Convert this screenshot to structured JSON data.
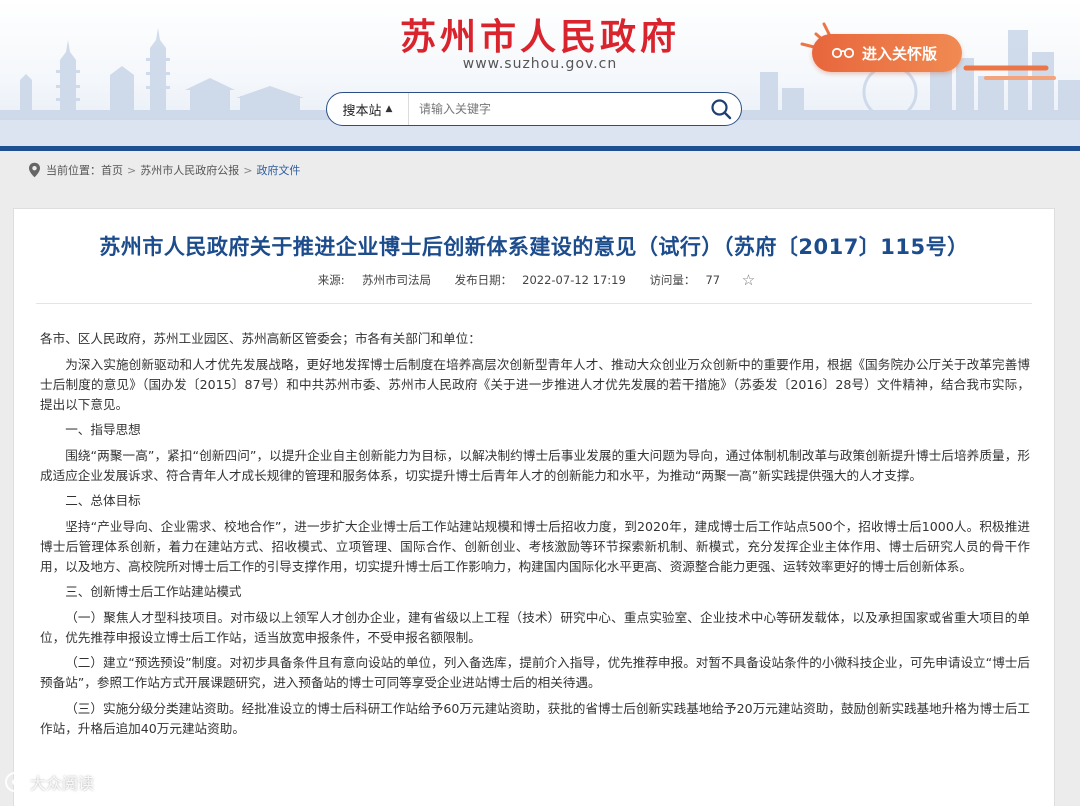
{
  "site": {
    "title": "苏州市人民政府",
    "url": "www.suzhou.gov.cn",
    "care_mode_label": "进入关怀版"
  },
  "search": {
    "scope_label": "搜本站",
    "placeholder": "请输入关键字"
  },
  "breadcrumb": {
    "label": "当前位置：",
    "items": [
      "首页",
      "苏州市人民政府公报",
      "政府文件"
    ]
  },
  "article": {
    "title": "苏州市人民政府关于推进企业博士后创新体系建设的意见（试行）（苏府〔2017〕115号）",
    "source_label": "来源:",
    "source": "苏州市司法局",
    "publish_label": "发布日期：",
    "publish_date": "2022-07-12 17:19",
    "views_label": "访问量：",
    "views": "77",
    "paragraphs": [
      "各市、区人民政府，苏州工业园区、苏州高新区管委会；市各有关部门和单位：",
      "为深入实施创新驱动和人才优先发展战略，更好地发挥博士后制度在培养高层次创新型青年人才、推动大众创业万众创新中的重要作用，根据《国务院办公厅关于改革完善博士后制度的意见》（国办发〔2015〕87号）和中共苏州市委、苏州市人民政府《关于进一步推进人才优先发展的若干措施》（苏委发〔2016〕28号）文件精神，结合我市实际，提出以下意见。",
      "一、指导思想",
      "围绕“两聚一高”，紧扣“创新四问”，以提升企业自主创新能力为目标，以解决制约博士后事业发展的重大问题为导向，通过体制机制改革与政策创新提升博士后培养质量，形成适应企业发展诉求、符合青年人才成长规律的管理和服务体系，切实提升博士后青年人才的创新能力和水平，为推动“两聚一高”新实践提供强大的人才支撑。",
      "二、总体目标",
      "坚持“产业导向、企业需求、校地合作”，进一步扩大企业博士后工作站建站规模和博士后招收力度，到2020年，建成博士后工作站点500个，招收博士后1000人。积极推进博士后管理体系创新，着力在建站方式、招收模式、立项管理、国际合作、创新创业、考核激励等环节探索新机制、新模式，充分发挥企业主体作用、博士后研究人员的骨干作用，以及地方、高校院所对博士后工作的引导支撑作用，切实提升博士后工作影响力，构建国内国际化水平更高、资源整合能力更强、运转效率更好的博士后创新体系。",
      "三、创新博士后工作站建站模式",
      "（一）聚焦人才型科技项目。对市级以上领军人才创办企业，建有省级以上工程（技术）研究中心、重点实验室、企业技术中心等研发载体，以及承担国家或省重大项目的单位，优先推荐申报设立博士后工作站，适当放宽申报条件，不受申报名额限制。",
      "（二）建立“预选预设”制度。对初步具备条件且有意向设站的单位，列入备选库，提前介入指导，优先推荐申报。对暂不具备设站条件的小微科技企业，可先申请设立“博士后预备站”，参照工作站方式开展课题研究，进入预备站的博士可同等享受企业进站博士后的相关待遇。",
      "（三）实施分级分类建站资助。经批准设立的博士后科研工作站给予60万元建站资助，获批的省博士后创新实践基地给予20万元建站资助，鼓励创新实践基地升格为博士后工作站，升格后追加40万元建站资助。"
    ]
  },
  "watermark": "大众阅读",
  "colors": {
    "brand_red": "#d9232d",
    "nav_blue": "#1e4f91",
    "title_blue": "#1c4c8c",
    "care_orange": "#ec7545"
  }
}
